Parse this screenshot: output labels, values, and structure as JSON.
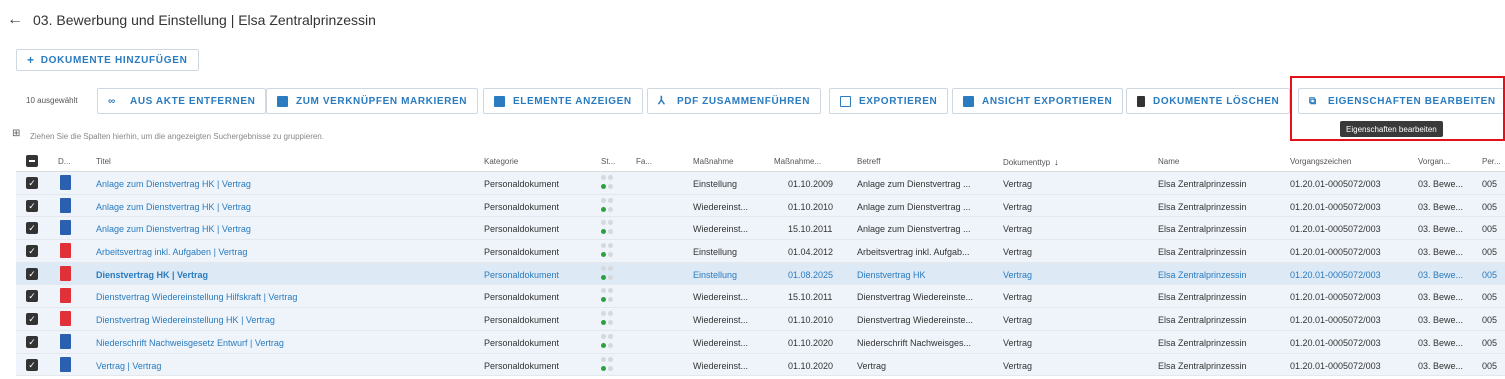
{
  "header": {
    "title": "03. Bewerbung und Einstellung | Elsa Zentralprinzessin"
  },
  "add_button": {
    "plus": "+",
    "label": "DOKUMENTE HINZUFÜGEN"
  },
  "toolbar": {
    "selected_count": "10 ausgewählt",
    "buttons": [
      {
        "label": "AUS AKTE ENTFERNEN",
        "icon": "unlink-icon"
      },
      {
        "label": "ZUM VERKNÜPFEN MARKIEREN",
        "icon": "link-mark-icon"
      },
      {
        "label": "ELEMENTE ANZEIGEN",
        "icon": "view-elements-icon"
      },
      {
        "label": "PDF ZUSAMMENFÜHREN",
        "icon": "pdf-merge-icon"
      },
      {
        "label": "EXPORTIEREN",
        "icon": "export-icon"
      },
      {
        "label": "ANSICHT EXPORTIEREN",
        "icon": "export-view-icon"
      },
      {
        "label": "DOKUMENTE LÖSCHEN",
        "icon": "trash-icon"
      },
      {
        "label": "EIGENSCHAFTEN BEARBEITEN",
        "icon": "edit-properties-icon"
      }
    ],
    "tooltip": "Eigenschaften bearbeiten"
  },
  "group_hint": "Ziehen Sie die Spalten hierhin, um die angezeigten Suchergebnisse zu gruppieren.",
  "columns": [
    "D...",
    "Titel",
    "Kategorie",
    "St...",
    "Fa...",
    "Maßnahme",
    "Maßnahme...",
    "Betreff",
    "Dokumenttyp",
    "Name",
    "Vorgangszeichen",
    "Vorgan...",
    "Per..."
  ],
  "sort_arrow": "↓",
  "rows": [
    {
      "type": "word",
      "title": "Anlage zum Dienstvertrag HK | Vertrag",
      "kategorie": "Personaldokument",
      "massnahme": "Einstellung",
      "datum": "01.10.2009",
      "betreff": "Anlage zum Dienstvertrag ...",
      "dokumenttyp": "Vertrag",
      "name": "Elsa Zentralprinzessin",
      "vorgangszeichen": "01.20.01-0005072/003",
      "vorgang": "03. Bewe...",
      "per": "005"
    },
    {
      "type": "word",
      "title": "Anlage zum Dienstvertrag HK | Vertrag",
      "kategorie": "Personaldokument",
      "massnahme": "Wiedereinst...",
      "datum": "01.10.2010",
      "betreff": "Anlage zum Dienstvertrag ...",
      "dokumenttyp": "Vertrag",
      "name": "Elsa Zentralprinzessin",
      "vorgangszeichen": "01.20.01-0005072/003",
      "vorgang": "03. Bewe...",
      "per": "005"
    },
    {
      "type": "word",
      "title": "Anlage zum Dienstvertrag HK | Vertrag",
      "kategorie": "Personaldokument",
      "massnahme": "Wiedereinst...",
      "datum": "15.10.2011",
      "betreff": "Anlage zum Dienstvertrag ...",
      "dokumenttyp": "Vertrag",
      "name": "Elsa Zentralprinzessin",
      "vorgangszeichen": "01.20.01-0005072/003",
      "vorgang": "03. Bewe...",
      "per": "005"
    },
    {
      "type": "pdf",
      "title": "Arbeitsvertrag inkl. Aufgaben | Vertrag",
      "kategorie": "Personaldokument",
      "massnahme": "Einstellung",
      "datum": "01.04.2012",
      "betreff": "Arbeitsvertrag inkl. Aufgab...",
      "dokumenttyp": "Vertrag",
      "name": "Elsa Zentralprinzessin",
      "vorgangszeichen": "01.20.01-0005072/003",
      "vorgang": "03. Bewe...",
      "per": "005"
    },
    {
      "type": "pdf",
      "title": "Dienstvertrag HK | Vertrag",
      "kategorie": "Personaldokument",
      "massnahme": "Einstellung",
      "datum": "01.08.2025",
      "betreff": "Dienstvertrag HK",
      "dokumenttyp": "Vertrag",
      "name": "Elsa Zentralprinzessin",
      "vorgangszeichen": "01.20.01-0005072/003",
      "vorgang": "03. Bewe...",
      "per": "005",
      "active": true
    },
    {
      "type": "pdf",
      "title": "Dienstvertrag Wiedereinstellung Hilfskraft | Vertrag",
      "kategorie": "Personaldokument",
      "massnahme": "Wiedereinst...",
      "datum": "15.10.2011",
      "betreff": "Dienstvertrag Wiedereinste...",
      "dokumenttyp": "Vertrag",
      "name": "Elsa Zentralprinzessin",
      "vorgangszeichen": "01.20.01-0005072/003",
      "vorgang": "03. Bewe...",
      "per": "005"
    },
    {
      "type": "pdf",
      "title": "Dienstvertrag Wiedereinstellung HK | Vertrag",
      "kategorie": "Personaldokument",
      "massnahme": "Wiedereinst...",
      "datum": "01.10.2010",
      "betreff": "Dienstvertrag Wiedereinste...",
      "dokumenttyp": "Vertrag",
      "name": "Elsa Zentralprinzessin",
      "vorgangszeichen": "01.20.01-0005072/003",
      "vorgang": "03. Bewe...",
      "per": "005"
    },
    {
      "type": "word",
      "title": "Niederschrift Nachweisgesetz Entwurf | Vertrag",
      "kategorie": "Personaldokument",
      "massnahme": "Wiedereinst...",
      "datum": "01.10.2020",
      "betreff": "Niederschrift Nachweisges...",
      "dokumenttyp": "Vertrag",
      "name": "Elsa Zentralprinzessin",
      "vorgangszeichen": "01.20.01-0005072/003",
      "vorgang": "03. Bewe...",
      "per": "005"
    },
    {
      "type": "word",
      "title": "Vertrag | Vertrag",
      "kategorie": "Personaldokument",
      "massnahme": "Wiedereinst...",
      "datum": "01.10.2020",
      "betreff": "Vertrag",
      "dokumenttyp": "Vertrag",
      "name": "Elsa Zentralprinzessin",
      "vorgangszeichen": "01.20.01-0005072/003",
      "vorgang": "03. Bewe...",
      "per": "005"
    }
  ],
  "colors": {
    "accent": "#2a7bbf",
    "highlight": "#e3121a",
    "word": "#2b5fb0",
    "pdf": "#e03038",
    "status_green": "#2ea043"
  }
}
